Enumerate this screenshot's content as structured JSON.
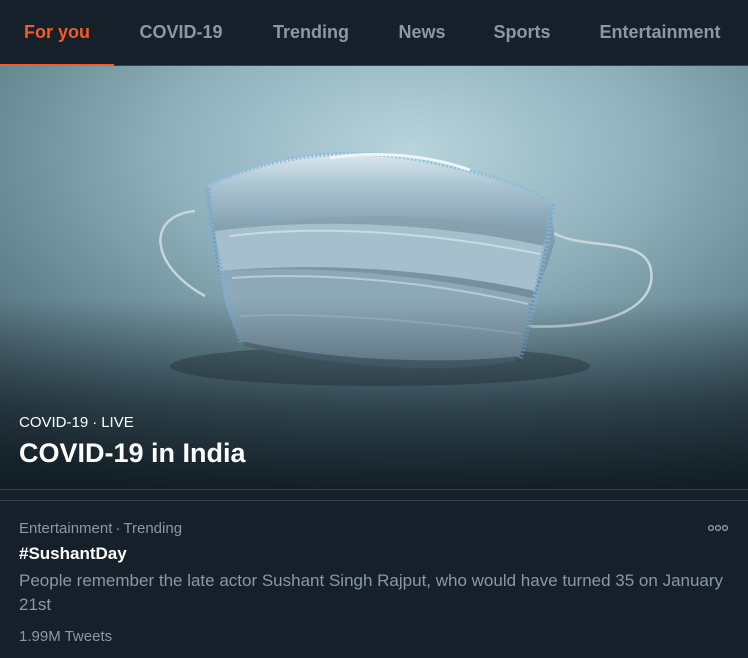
{
  "tabs": [
    {
      "label": "For you",
      "active": true
    },
    {
      "label": "COVID-19",
      "active": false
    },
    {
      "label": "Trending",
      "active": false
    },
    {
      "label": "News",
      "active": false
    },
    {
      "label": "Sports",
      "active": false
    },
    {
      "label": "Entertainment",
      "active": false
    }
  ],
  "hero": {
    "category": "COVID-19",
    "live_label": "LIVE",
    "separator": "·",
    "title": "COVID-19 in India",
    "image": "surgical-face-mask-photo"
  },
  "trend": {
    "category": "Entertainment",
    "status": "Trending",
    "separator": "·",
    "title": "#SushantDay",
    "description": "People remember the late actor Sushant Singh Rajput, who would have turned 35 on January 21st",
    "count": "1.99M Tweets",
    "more_icon": "more-dots-icon"
  },
  "colors": {
    "background": "#15202b",
    "accent": "#f45d22",
    "muted_text": "#8899a6",
    "border": "#38444d"
  }
}
